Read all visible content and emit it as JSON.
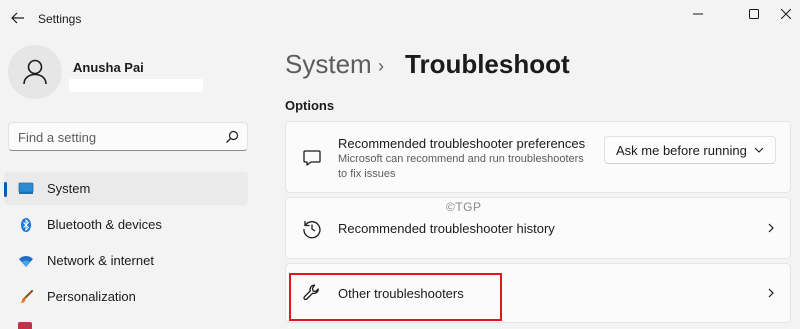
{
  "window": {
    "title": "Settings"
  },
  "profile": {
    "name": "Anusha Pai"
  },
  "search": {
    "placeholder": "Find a setting"
  },
  "sidebar": {
    "items": [
      {
        "label": "System",
        "icon": "monitor-icon",
        "selected": true
      },
      {
        "label": "Bluetooth & devices",
        "icon": "bluetooth-icon"
      },
      {
        "label": "Network & internet",
        "icon": "wifi-icon"
      },
      {
        "label": "Personalization",
        "icon": "brush-icon"
      }
    ]
  },
  "breadcrumb": {
    "parent": "System",
    "separator": "›",
    "current": "Troubleshoot"
  },
  "main": {
    "section_title": "Options",
    "cards": [
      {
        "title": "Recommended troubleshooter preferences",
        "description_line1": "Microsoft can recommend and run troubleshooters",
        "description_line2": "to fix issues",
        "icon": "message-icon",
        "control": {
          "type": "dropdown",
          "value": "Ask me before running"
        }
      },
      {
        "title": "Recommended troubleshooter history",
        "icon": "history-icon"
      },
      {
        "title": "Other troubleshooters",
        "icon": "wrench-icon"
      }
    ]
  },
  "watermark": "©TGP",
  "colors": {
    "accent": "#005fb8",
    "highlight": "#e0171d",
    "background": "#f3f3f3",
    "card": "#fbfbfb"
  }
}
